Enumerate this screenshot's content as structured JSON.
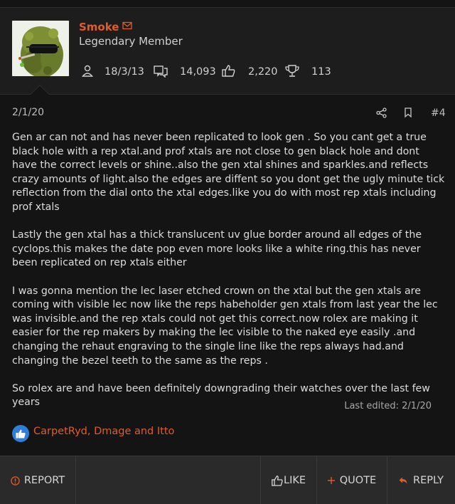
{
  "user": {
    "name": "Smoke",
    "title": "Legendary Member",
    "joined": "18/3/13",
    "messages": "14,093",
    "reactions": "2,220",
    "points": "113"
  },
  "post": {
    "date": "2/1/20",
    "number": "#4",
    "paragraphs": [
      "Gen ar can not and has never been replicated to look gen . So you cant get a true black hole with a rep xtal.and prof xtals are not close to gen black hole and dont have the correct levels or shine..also the gen xtal shines and sparkles.and reflects crazy amounts of light.also the edges are diffent so you dont get the ugly minute tick reflection from the dial onto the xtal edges.like you do with most rep xtals including prof xtals",
      "Lastly the gen xtal has a thick translucent uv glue border around all edges of the cyclops.this makes the date pop even more looks like a white ring.this has never been replicated on rep xtals either",
      "I was gonna mention the lec laser etched crown on the xtal but the gen xtals are coming with visible lec now like the reps habeholder gen xtals from last year the lec was invisible.and the rep xtals could not get this correct.now rolex are making it easier for the rep makers by making the lec visible to the naked eye easily .and changing the rehaut engraving to the single line like the reps always had.and changing the bezel teeth to the same as the reps .",
      "So rolex are and have been definitely downgrading their watches over the last few years"
    ],
    "last_edited": "Last edited: 2/1/20",
    "reactors": "CarpetRyd, Dmage and Itto"
  },
  "actions": {
    "report": "REPORT",
    "like": "LIKE",
    "quote": "QUOTE",
    "reply": "REPLY"
  },
  "icons": [
    "mail-icon",
    "user-icon",
    "messages-icon",
    "thumbs-up-icon",
    "trophy-icon",
    "share-icon",
    "bookmark-icon",
    "warning-icon",
    "plus-icon",
    "reply-arrow-icon"
  ],
  "colors": {
    "accent": "#e05d2b",
    "like": "#2d7fd8",
    "background": "#141414"
  }
}
